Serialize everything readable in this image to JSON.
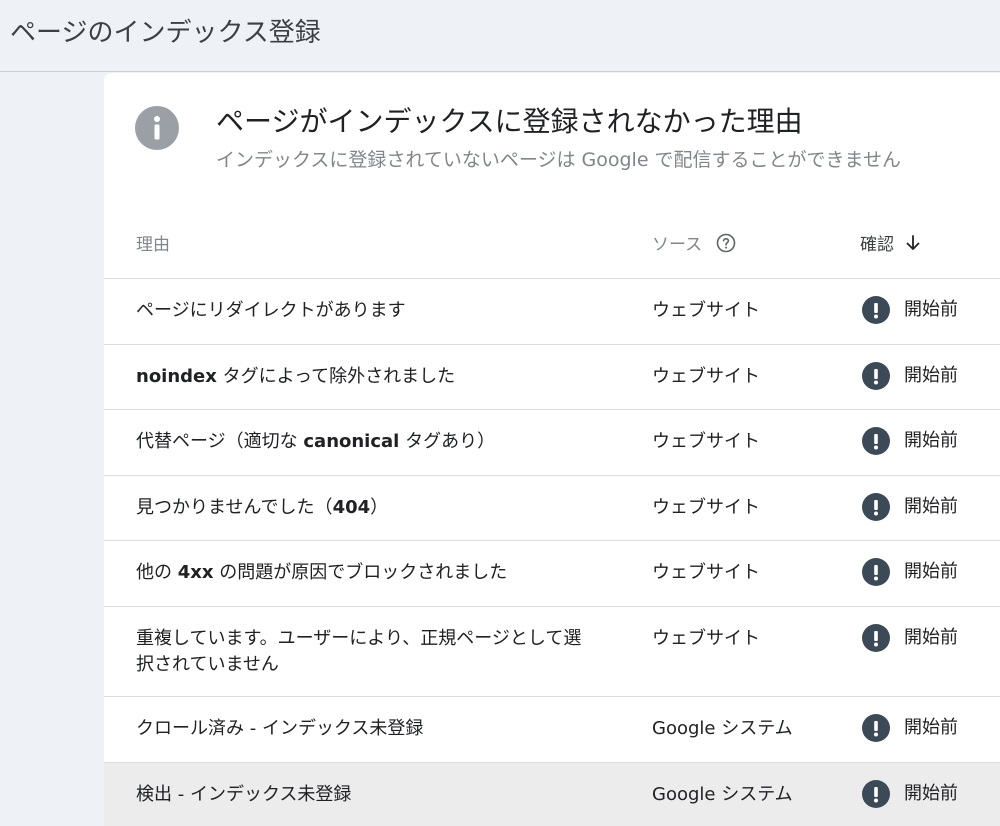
{
  "page": {
    "title": "ページのインデックス登録"
  },
  "card": {
    "title": "ページがインデックスに登録されなかった理由",
    "subtitle": "インデックスに登録されていないページは Google で配信することができません",
    "icon": "info-icon"
  },
  "table": {
    "headers": {
      "reason": "理由",
      "source": "ソース",
      "verification": "確認"
    },
    "rows": [
      {
        "reason_parts": [
          {
            "text": "ページにリダイレクトがあります",
            "bold": false
          }
        ],
        "source": "ウェブサイト",
        "status": "開始前",
        "height": 66
      },
      {
        "reason_parts": [
          {
            "text": "noindex",
            "bold": true
          },
          {
            "text": " タグによって除外されました",
            "bold": false
          }
        ],
        "source": "ウェブサイト",
        "status": "開始前",
        "height": 65
      },
      {
        "reason_parts": [
          {
            "text": "代替ページ（適切な ",
            "bold": false
          },
          {
            "text": "canonical",
            "bold": true
          },
          {
            "text": " タグあり）",
            "bold": false
          }
        ],
        "source": "ウェブサイト",
        "status": "開始前",
        "height": 66
      },
      {
        "reason_parts": [
          {
            "text": "見つかりませんでした（",
            "bold": false
          },
          {
            "text": "404",
            "bold": true
          },
          {
            "text": "）",
            "bold": false
          }
        ],
        "source": "ウェブサイト",
        "status": "開始前",
        "height": 65
      },
      {
        "reason_parts": [
          {
            "text": "他の ",
            "bold": false
          },
          {
            "text": "4xx",
            "bold": true
          },
          {
            "text": " の問題が原因でブロックされました",
            "bold": false
          }
        ],
        "source": "ウェブサイト",
        "status": "開始前",
        "height": 66
      },
      {
        "reason_parts": [
          {
            "text": "重複しています。ユーザーにより、正規ページとして選択されていません",
            "bold": false
          }
        ],
        "source": "ウェブサイト",
        "status": "開始前",
        "height": 90
      },
      {
        "reason_parts": [
          {
            "text": "クロール済み - インデックス未登録",
            "bold": false
          }
        ],
        "source": "Google システム",
        "status": "開始前",
        "height": 66
      },
      {
        "reason_parts": [
          {
            "text": "検出 - インデックス未登録",
            "bold": false
          }
        ],
        "source": "Google システム",
        "status": "開始前",
        "height": 66,
        "highlight": true
      }
    ]
  }
}
